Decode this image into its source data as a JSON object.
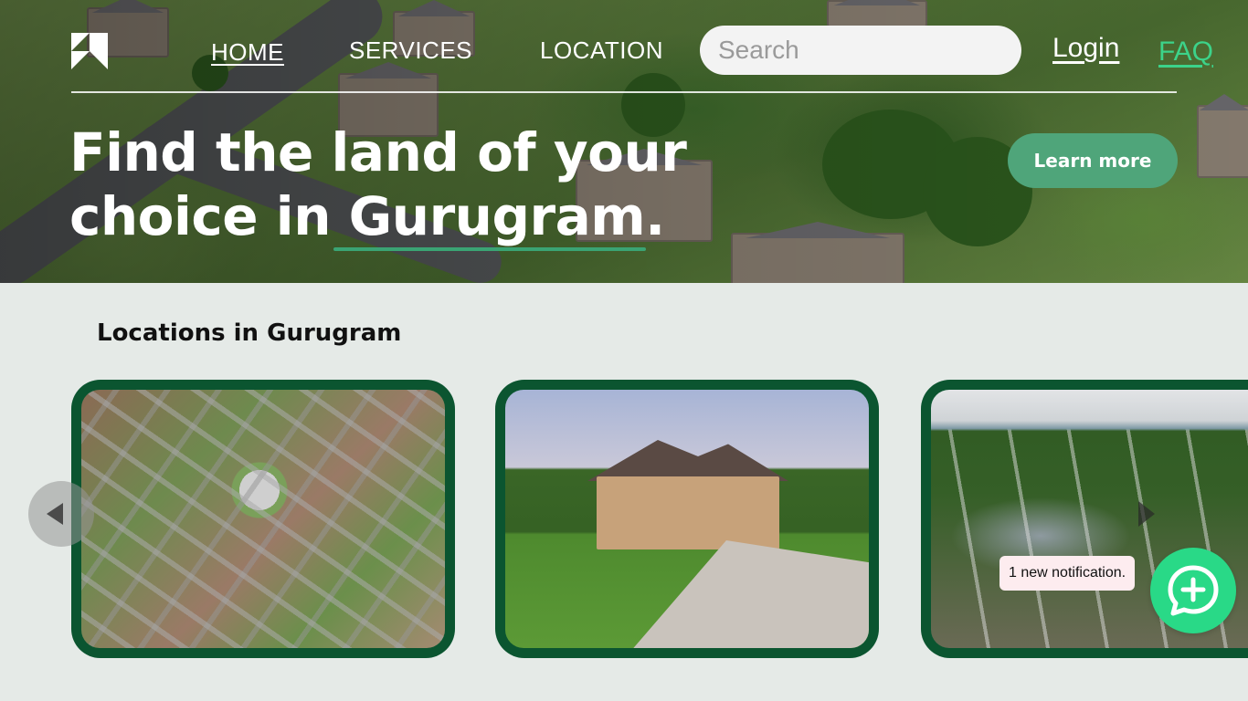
{
  "nav": {
    "home": "HOME",
    "services": "SERVICES",
    "location": "LOCATION",
    "search_placeholder": "Search",
    "login": "Login",
    "faq": "FAQ"
  },
  "hero": {
    "headline_line1": "Find the land of your",
    "headline_line2": "choice in Gurugram.",
    "cta_label": "Learn more"
  },
  "locations": {
    "title": "Locations in Gurugram",
    "cards": [
      {
        "image": "aerial-roundabout-neighbourhood"
      },
      {
        "image": "stone-house-with-driveway"
      },
      {
        "image": "aerial-town-road"
      }
    ]
  },
  "notification": {
    "text": "1 new notification."
  },
  "colors": {
    "accent_green": "#4fa57a",
    "card_border": "#0b5530",
    "faq_link": "#3cd38a",
    "chat_button": "#29d987",
    "page_bg": "#e5eae7"
  },
  "icons": {
    "logo": "logo-icon",
    "chat": "chat-plus-icon",
    "prev": "chevron-left-icon",
    "next": "chevron-right-icon"
  }
}
